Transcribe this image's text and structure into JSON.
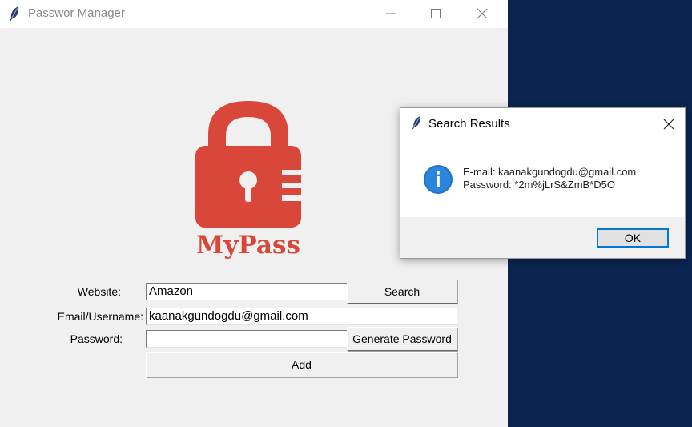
{
  "window": {
    "title": "Passwor Manager"
  },
  "logo": {
    "text": "MyPass",
    "color": "#d9473a"
  },
  "form": {
    "website_label": "Website:",
    "website_value": "Amazon",
    "email_label": "Email/Username:",
    "email_value": "kaanakgundogdu@gmail.com",
    "password_label": "Password:",
    "password_value": "",
    "search_label": "Search",
    "generate_label": "Generate Password",
    "add_label": "Add"
  },
  "dialog": {
    "title": "Search Results",
    "line1": "E-mail: kaanakgundogdu@gmail.com",
    "line2": "Password: *2m%jLrS&ZmB*D5O",
    "ok_label": "OK",
    "icon": "info-icon"
  },
  "colors": {
    "desktop": "#0b2550",
    "accent": "#0078d7",
    "info": "#1a73c8"
  }
}
